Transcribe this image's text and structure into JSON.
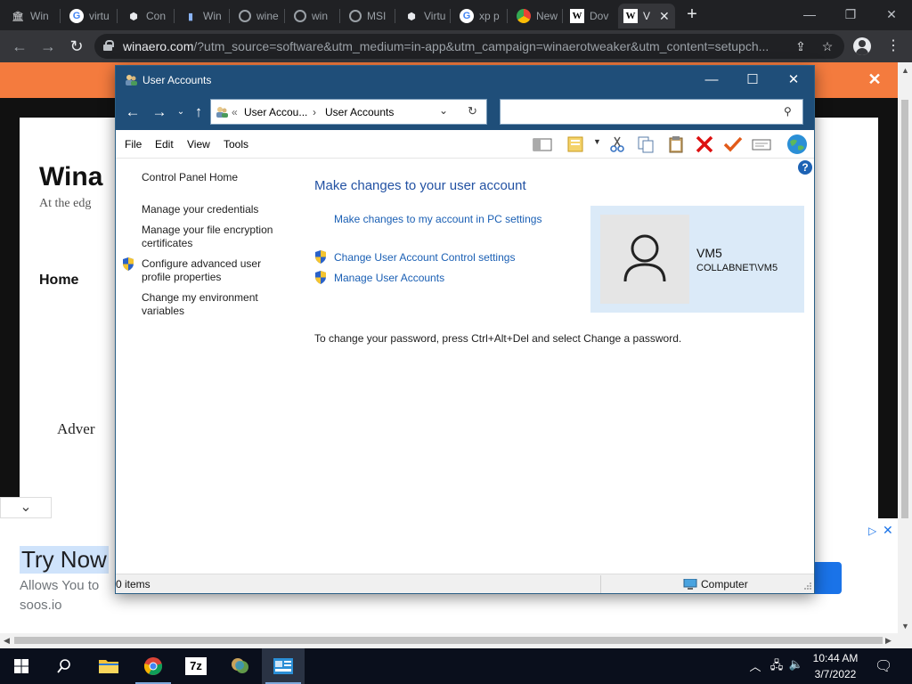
{
  "browser": {
    "tabs": [
      {
        "label": "Win",
        "icon": "columns-icon"
      },
      {
        "label": "virtu",
        "icon": "google-icon"
      },
      {
        "label": "Con",
        "icon": "virtualbox-icon"
      },
      {
        "label": "Win",
        "icon": "doc-icon"
      },
      {
        "label": "wine",
        "icon": "globe-icon"
      },
      {
        "label": "win",
        "icon": "globe-icon"
      },
      {
        "label": "MSI",
        "icon": "globe-icon"
      },
      {
        "label": "Virtu",
        "icon": "virtualbox-icon"
      },
      {
        "label": "xp p",
        "icon": "google-icon"
      },
      {
        "label": "New",
        "icon": "chrome-icon"
      },
      {
        "label": "Dov",
        "icon": "winaero-icon"
      },
      {
        "label": "V",
        "icon": "winaero-icon",
        "active": true
      }
    ],
    "url_host": "winaero.com",
    "url_rest": "/?utm_source=software&utm_medium=in-app&utm_campaign=winaerotweaker&utm_content=setupch..."
  },
  "site": {
    "title": "Wina",
    "tagline": "At the edg",
    "home": "Home",
    "adv": "Adver",
    "ad": {
      "title": "Try Now",
      "body": "Allows You to",
      "domain": "soos.io"
    }
  },
  "window": {
    "title": "User Accounts",
    "breadcrumb_root": "User Accou...",
    "breadcrumb_current": "User Accounts",
    "breadcrumb_sep": "›",
    "breadcrumb_prefix": "«",
    "menu": [
      "File",
      "Edit",
      "View",
      "Tools"
    ],
    "sidebar": [
      "Control Panel Home",
      "Manage your credentials",
      "Manage your file encryption certificates",
      "Configure advanced user profile properties",
      "Change my environment variables"
    ],
    "heading": "Make changes to your user account",
    "links": [
      "Make changes to my account in PC settings",
      "Change User Account Control settings",
      "Manage User Accounts"
    ],
    "password_note": "To change your password, press Ctrl+Alt+Del and select Change a password.",
    "user": {
      "name": "VM5",
      "domain": "COLLABNET\\VM5"
    },
    "status_items": "0 items",
    "status_location": "Computer",
    "help": "?"
  },
  "taskbar": {
    "time": "10:44 AM",
    "date": "3/7/2022",
    "sevenzip_label": "7z"
  },
  "colors": {
    "accent_orange": "#f47b3e",
    "window_titlebar": "#1f4e79",
    "link_blue": "#1a5fb4"
  }
}
